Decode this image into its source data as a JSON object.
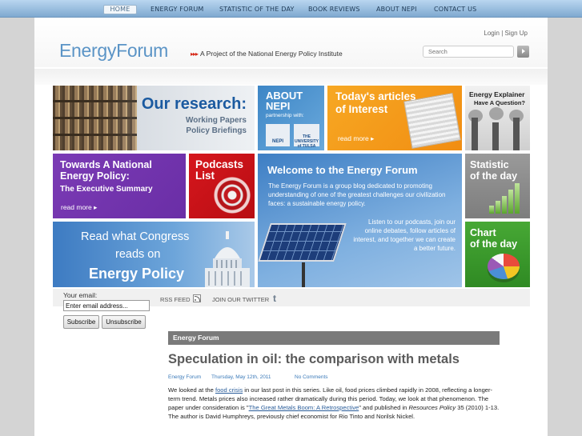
{
  "nav": {
    "items": [
      {
        "label": "HOME",
        "active": true
      },
      {
        "label": "ENERGY FORUM",
        "active": false
      },
      {
        "label": "STATISTIC OF THE DAY",
        "active": false
      },
      {
        "label": "BOOK REVIEWS",
        "active": false
      },
      {
        "label": "ABOUT NEPI",
        "active": false
      },
      {
        "label": "CONTACT US",
        "active": false
      }
    ]
  },
  "header": {
    "logo": "EnergyForum",
    "tagline_arrows": "▸▸▸",
    "tagline": "A Project of the National Energy Policy Institute",
    "login": "Login",
    "separator": "|",
    "signup": "Sign Up",
    "search_placeholder": "Search"
  },
  "tiles": {
    "research": {
      "title": "Our research:",
      "line1": "Working Papers",
      "line2": "Policy Briefings"
    },
    "about": {
      "title1": "ABOUT",
      "title2": "NEPI",
      "partnership": "partnership with:",
      "logo1": "NEPI",
      "logo2_a": "THE",
      "logo2_b": "UNIVERSITY",
      "logo2_c": "of TULSA"
    },
    "today": {
      "title1": "Today's articles",
      "title2": "of Interest",
      "more": "read more ▸"
    },
    "explainer": {
      "title": "Energy Explainer",
      "sub": "Have A Question?"
    },
    "national": {
      "title1": "Towards A National",
      "title2": "Energy Policy:",
      "sub": "The Executive Summary",
      "more": "read more ▸"
    },
    "podcasts": {
      "title1": "Podcasts",
      "title2": "List"
    },
    "welcome": {
      "title": "Welcome to the Energy Forum",
      "text1": "The Energy Forum is a group blog dedicated to promoting understanding of one of the greatest challenges our civilization faces: a sustainable energy policy.",
      "text2": "Listen to our podcasts, join our online debates, follow articles of interest, and together we can create a better future."
    },
    "statday": {
      "title1": "Statistic",
      "title2": "of the day"
    },
    "congress": {
      "line1": "Read what Congress",
      "line2": "reads on",
      "line3": "Energy Policy"
    },
    "chartday": {
      "title1": "Chart",
      "title2": "of the day"
    }
  },
  "subscribe": {
    "label": "Your email:",
    "value": "Enter email address...",
    "subscribe_btn": "Subscribe",
    "unsubscribe_btn": "Unsubscribe"
  },
  "social": {
    "rss": "RSS FEED",
    "twitter": "JOIN OUR TWITTER",
    "twitter_glyph": "t"
  },
  "post": {
    "section": "Energy Forum",
    "title": "Speculation in oil: the comparison with metals",
    "author": "Energy Forum",
    "date": "Thursday, May 12th, 2011",
    "comments": "No Comments",
    "p_a": "We looked at the ",
    "link1": "food crisis",
    "p_b": " in our last post in this series.  Like oil, food prices climbed rapidly in 2008, reflecting a longer-term trend.  Metals prices also increased rather dramatically during this period.  Today, we look at that phenomenon.  The paper under consideration is \"",
    "link2": "The Great Metals Boom: A Retrospective",
    "p_c": "\" and published in ",
    "journal": "Resources Policy",
    "p_d": " 35 (2010) 1-13.  The author is David Humphreys, previously chief economist for Rio Tinto and Norilsk Nickel."
  },
  "colors": {
    "accent": "#5b94c6",
    "nav_bar": "#8fb6dc",
    "section_bar": "#7a7a7a"
  }
}
